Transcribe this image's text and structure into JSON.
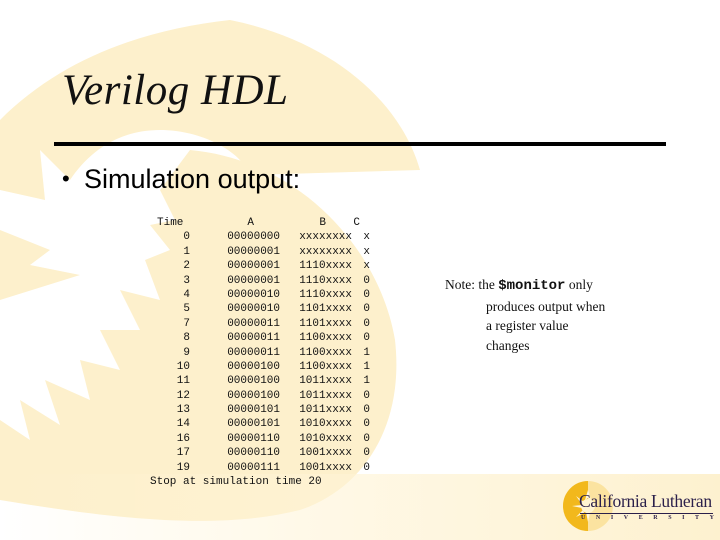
{
  "slide": {
    "title": "Verilog HDL",
    "bullet": "Simulation output:",
    "bullet_glyph": "•"
  },
  "simulation": {
    "headers": {
      "time": "Time",
      "a": "A",
      "b": "B",
      "c": "C"
    },
    "rows": [
      {
        "time": "0",
        "a": "00000000",
        "b": "xxxxxxxx",
        "c": "x"
      },
      {
        "time": "1",
        "a": "00000001",
        "b": "xxxxxxxx",
        "c": "x"
      },
      {
        "time": "2",
        "a": "00000001",
        "b": "1110xxxx",
        "c": "x"
      },
      {
        "time": "3",
        "a": "00000001",
        "b": "1110xxxx",
        "c": "0"
      },
      {
        "time": "4",
        "a": "00000010",
        "b": "1110xxxx",
        "c": "0"
      },
      {
        "time": "5",
        "a": "00000010",
        "b": "1101xxxx",
        "c": "0"
      },
      {
        "time": "7",
        "a": "00000011",
        "b": "1101xxxx",
        "c": "0"
      },
      {
        "time": "8",
        "a": "00000011",
        "b": "1100xxxx",
        "c": "0"
      },
      {
        "time": "9",
        "a": "00000011",
        "b": "1100xxxx",
        "c": "1"
      },
      {
        "time": "10",
        "a": "00000100",
        "b": "1100xxxx",
        "c": "1"
      },
      {
        "time": "11",
        "a": "00000100",
        "b": "1011xxxx",
        "c": "1"
      },
      {
        "time": "12",
        "a": "00000100",
        "b": "1011xxxx",
        "c": "0"
      },
      {
        "time": "13",
        "a": "00000101",
        "b": "1011xxxx",
        "c": "0"
      },
      {
        "time": "14",
        "a": "00000101",
        "b": "1010xxxx",
        "c": "0"
      },
      {
        "time": "16",
        "a": "00000110",
        "b": "1010xxxx",
        "c": "0"
      },
      {
        "time": "17",
        "a": "00000110",
        "b": "1001xxxx",
        "c": "0"
      },
      {
        "time": "19",
        "a": "00000111",
        "b": "1001xxxx",
        "c": "0"
      }
    ],
    "stop_message": "Stop at simulation time 20"
  },
  "note": {
    "prefix": "Note: the ",
    "keyword": "$monitor",
    "line1_suffix": " only",
    "line2": "produces output when",
    "line3": "a register value",
    "line4": "changes"
  },
  "logo": {
    "name": "California Lutheran",
    "sub_letters": [
      "U",
      "N",
      "I",
      "V",
      "E",
      "R",
      "S",
      "I",
      "T",
      "Y"
    ]
  },
  "colors": {
    "watermark": "#fdf0cc",
    "logo_sun": "#f2b81c",
    "logo_text": "#2a1f4a"
  }
}
